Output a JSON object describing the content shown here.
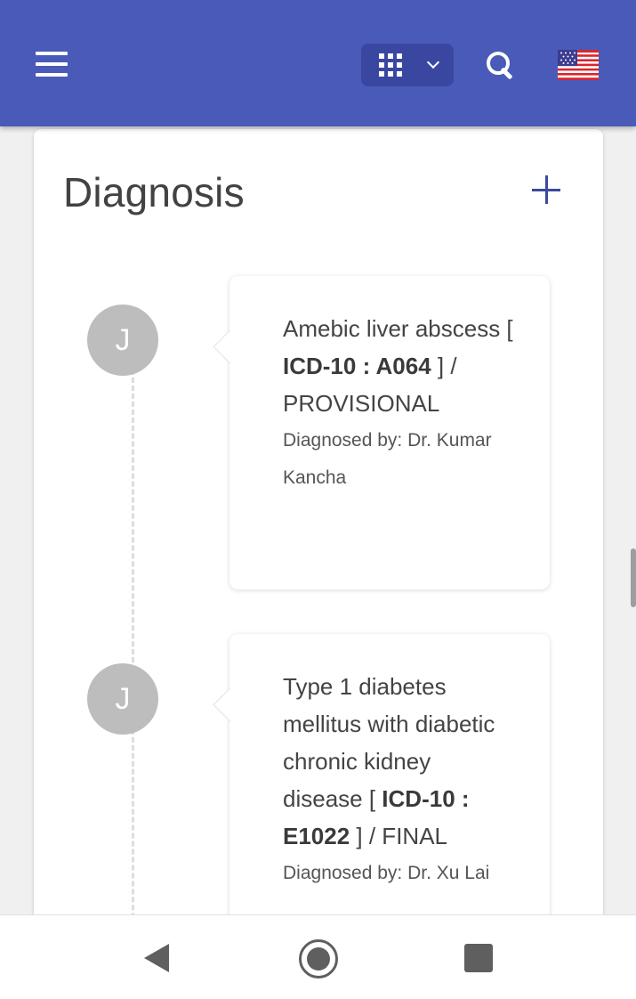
{
  "app": {
    "accent_color": "#4a5ab8"
  },
  "header": {
    "menu_icon": "hamburger-menu-icon",
    "apps_icon": "apps-grid-icon",
    "dropdown_icon": "chevron-down-icon",
    "search_icon": "search-icon",
    "flag_icon": "us-flag-icon"
  },
  "card": {
    "title": "Diagnosis",
    "add_icon": "plus-icon"
  },
  "entries": [
    {
      "avatar_initial": "J",
      "text_before": "Amebic liver abscess [ ",
      "code_label": "ICD-10 : A064",
      "text_after": " ] / PROVISIONAL",
      "diagnosed_by": "Diagnosed by: Dr. Kumar Kancha"
    },
    {
      "avatar_initial": "J",
      "text_before": "Type 1 diabetes mellitus with diabetic chronic kidney disease [ ",
      "code_label": "ICD-10 : E1022",
      "text_after": " ] / FINAL",
      "diagnosed_by": "Diagnosed by: Dr. Xu Lai"
    }
  ],
  "navbar": {
    "back_icon": "back-triangle-icon",
    "home_icon": "home-circle-icon",
    "recents_icon": "recents-square-icon"
  }
}
